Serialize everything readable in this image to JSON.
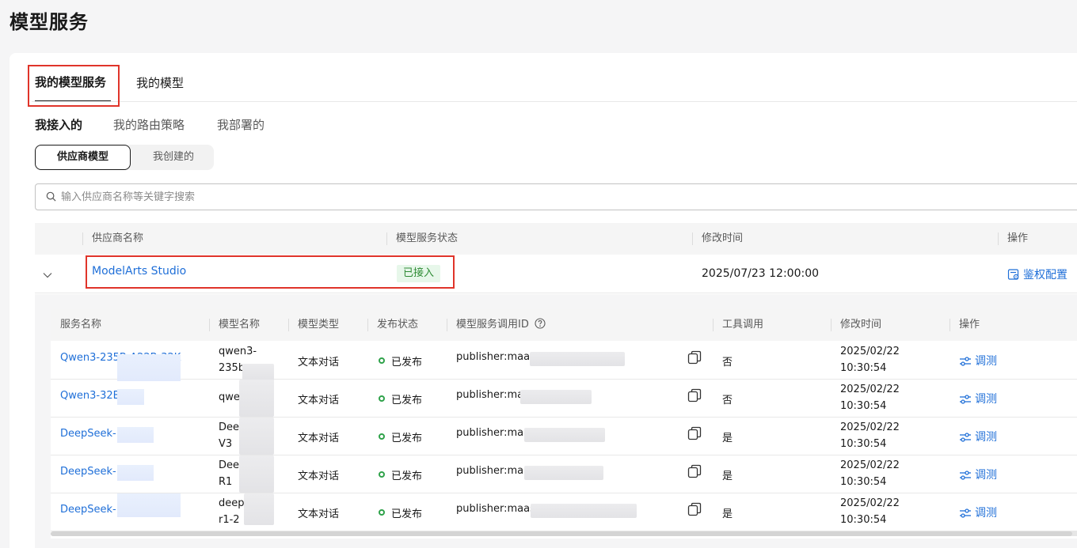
{
  "page": {
    "title": "模型服务"
  },
  "tabs": [
    {
      "label": "我的模型服务",
      "active": true
    },
    {
      "label": "我的模型",
      "active": false
    }
  ],
  "sub_tabs": [
    {
      "label": "我接入的",
      "active": true
    },
    {
      "label": "我的路由策略",
      "active": false
    },
    {
      "label": "我部署的",
      "active": false
    }
  ],
  "segments": [
    {
      "label": "供应商模型",
      "active": true
    },
    {
      "label": "我创建的",
      "active": false
    }
  ],
  "search": {
    "placeholder": "输入供应商名称等关键字搜索",
    "value": ""
  },
  "providers_table": {
    "headers": [
      "供应商名称",
      "模型服务状态",
      "修改时间",
      "操作"
    ],
    "rows": [
      {
        "provider": "ModelArts Studio",
        "status": "已接入",
        "modified": "2025/07/23 12:00:00",
        "action": "鉴权配置",
        "expanded": true
      }
    ]
  },
  "services_table": {
    "headers": [
      "服务名称",
      "模型名称",
      "模型类型",
      "发布状态",
      "模型服务调用ID",
      "工具调用",
      "修改时间",
      "操作"
    ],
    "rows": [
      {
        "service": "Qwen3-235B-A22B-32K",
        "model_l1": "qwen3-",
        "model_l2": "235b",
        "type": "文本对话",
        "status": "已发布",
        "call_id": "publisher:maas",
        "tool": "否",
        "date": "2025/02/22",
        "time": "10:30:54",
        "action": "调测"
      },
      {
        "service": "Qwen3-32B",
        "model_l1": "qwe",
        "model_l2": "",
        "type": "文本对话",
        "status": "已发布",
        "call_id": "publisher:ma",
        "tool": "否",
        "date": "2025/02/22",
        "time": "10:30:54",
        "action": "调测"
      },
      {
        "service": "DeepSeek-",
        "model_l1": "Dee",
        "model_l2": "V3",
        "type": "文本对话",
        "status": "已发布",
        "call_id": "publisher:maa",
        "tool": "是",
        "date": "2025/02/22",
        "time": "10:30:54",
        "action": "调测"
      },
      {
        "service": "DeepSeek-",
        "model_l1": "Dee",
        "model_l2": "R1",
        "type": "文本对话",
        "status": "已发布",
        "call_id": "publisher:maa",
        "tool": "是",
        "date": "2025/02/22",
        "time": "10:30:54",
        "action": "调测"
      },
      {
        "service": "DeepSeek-",
        "model_l1": "deep",
        "model_l2": "r1-2",
        "type": "文本对话",
        "status": "已发布",
        "call_id": "publisher:maas",
        "tool": "是",
        "date": "2025/02/22",
        "time": "10:30:54",
        "action": "调测"
      }
    ]
  },
  "colors": {
    "link": "#1f6fd8",
    "success": "#2fa24a",
    "highlight_box": "#e0342a"
  },
  "icons": [
    "search-icon",
    "chevron-down-icon",
    "auth-config-icon",
    "help-circle-icon",
    "copy-icon",
    "tune-icon"
  ]
}
